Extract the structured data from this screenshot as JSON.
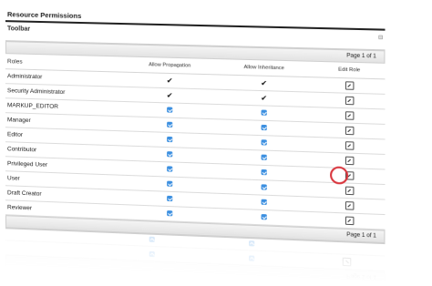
{
  "panel": {
    "title": "Resource Permissions",
    "toolbar_label": "Toolbar",
    "collapse_glyph": "⊟"
  },
  "pager": {
    "top_text": "Page 1 of 1",
    "bottom_text": "Page 1 of 1"
  },
  "table": {
    "headers": {
      "roles": "Roles",
      "propagation": "Allow Propagation",
      "inheritance": "Allow Inheritance",
      "edit": "Edit Role"
    },
    "rows": [
      {
        "role": "Administrator",
        "propagation": "tick",
        "inheritance": "tick"
      },
      {
        "role": "Security Administrator",
        "propagation": "tick",
        "inheritance": "tick"
      },
      {
        "role": "MARKUP_EDITOR",
        "propagation": "checkbox",
        "inheritance": "checkbox"
      },
      {
        "role": "Manager",
        "propagation": "checkbox",
        "inheritance": "checkbox"
      },
      {
        "role": "Editor",
        "propagation": "checkbox",
        "inheritance": "checkbox"
      },
      {
        "role": "Contributor",
        "propagation": "checkbox",
        "inheritance": "checkbox"
      },
      {
        "role": "Privileged User",
        "propagation": "checkbox",
        "inheritance": "checkbox"
      },
      {
        "role": "User",
        "propagation": "checkbox",
        "inheritance": "checkbox"
      },
      {
        "role": "Draft Creator",
        "propagation": "checkbox",
        "inheritance": "checkbox"
      },
      {
        "role": "Reviewer",
        "propagation": "checkbox",
        "inheritance": "checkbox"
      }
    ],
    "highlighted_edit_row": "Privileged User"
  },
  "icons": {
    "tick": "check-icon",
    "checkbox": "checked-checkbox-icon",
    "edit": "edit-role-icon"
  },
  "colors": {
    "checkbox": "#3b8fe0",
    "highlight": "#d9363e"
  }
}
